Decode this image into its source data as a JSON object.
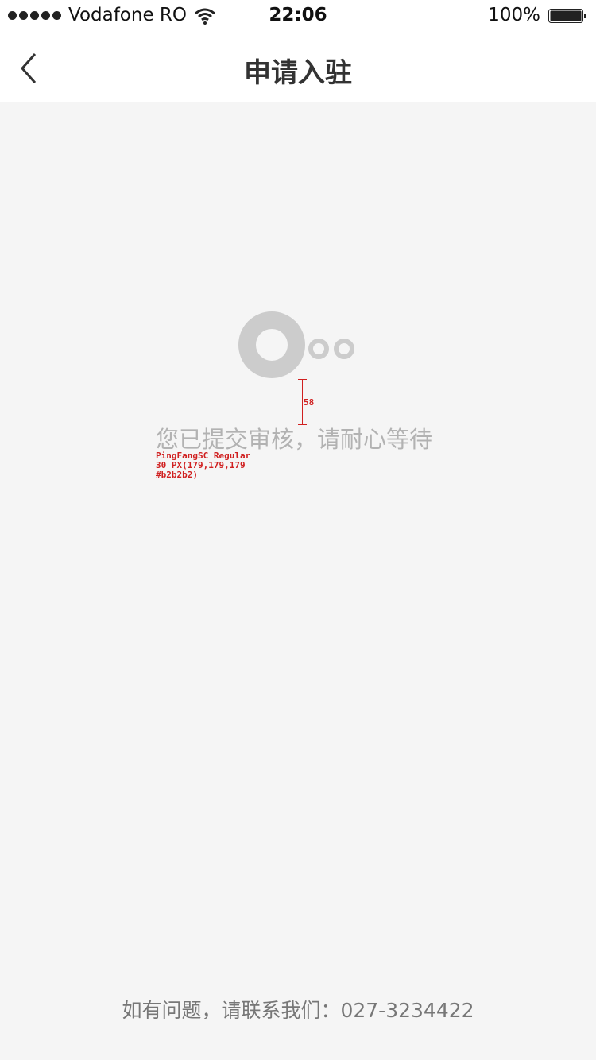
{
  "status_bar": {
    "carrier": "Vodafone RO",
    "time": "22:06",
    "battery_percent": "100%",
    "battery_level": 1.0,
    "signal_bars": 5,
    "icons": [
      "signal-dots-icon",
      "wifi-icon",
      "battery-icon"
    ]
  },
  "nav": {
    "title": "申请入驻",
    "back_icon": "chevron-left-icon"
  },
  "main": {
    "logo_icon": "loading-logo-icon",
    "message": "您已提交审核，请耐心等待"
  },
  "annotations": {
    "spacing_label": "58",
    "font_spec_line1": "PingFangSC Regular",
    "font_spec_line2": "30 PX(179,179,179",
    "font_spec_line3": "#b2b2b2)"
  },
  "footer": {
    "contact": "如有问题，请联系我们：027-3234422"
  },
  "colors": {
    "background": "#f5f5f5",
    "message_text": "#b2b2b2",
    "annotation": "#d02020",
    "logo": "#cccccc"
  }
}
